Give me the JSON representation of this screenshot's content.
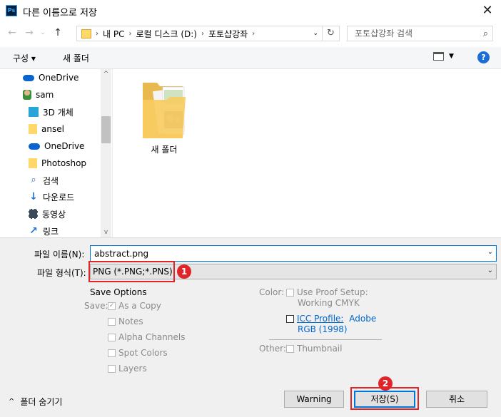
{
  "window": {
    "title": "다른 이름으로 저장",
    "app_icon": "Ps",
    "close": "✕"
  },
  "address": {
    "path": [
      "내 PC",
      "로컬 디스크 (D:)",
      "포토샵강좌"
    ]
  },
  "search": {
    "placeholder": "포토샵강좌 검색"
  },
  "toolbar": {
    "organize": "구성 ▾",
    "new_folder": "새 폴더",
    "help": "?"
  },
  "nav": {
    "items": [
      {
        "label": "OneDrive",
        "icon": "cloud-icon"
      },
      {
        "label": "sam",
        "icon": "user-icon"
      },
      {
        "label": "3D 개체",
        "icon": "3d-objects-icon"
      },
      {
        "label": "ansel",
        "icon": "folder-icon"
      },
      {
        "label": "OneDrive",
        "icon": "cloud-icon"
      },
      {
        "label": "Photoshop",
        "icon": "folder-icon"
      },
      {
        "label": "검색",
        "icon": "search-icon"
      },
      {
        "label": "다운로드",
        "icon": "download-icon"
      },
      {
        "label": "동영상",
        "icon": "video-icon"
      },
      {
        "label": "링크",
        "icon": "link-icon"
      }
    ]
  },
  "files": [
    {
      "label": "새 폴더",
      "icon": "folder-icon"
    }
  ],
  "form": {
    "filename_label": "파일 이름(N):",
    "filename_value": "abstract.png",
    "filetype_label": "파일 형식(T):",
    "filetype_value": "PNG (*.PNG;*.PNS)"
  },
  "save_options": {
    "title": "Save Options",
    "save_label": "Save:",
    "options": [
      "As a Copy",
      "Notes",
      "Alpha Channels",
      "Spot Colors",
      "Layers"
    ],
    "color_label": "Color:",
    "proof_setup": "Use Proof Setup:",
    "proof_value": "Working CMYK",
    "icc_link": "ICC Profile:",
    "icc_value": "Adobe",
    "icc_value2": "RGB (1998)",
    "other_label": "Other:",
    "thumbnail": "Thumbnail"
  },
  "footer": {
    "hide_folders": "폴더 숨기기",
    "warning": "Warning",
    "save": "저장(S)",
    "cancel": "취소"
  },
  "badges": {
    "one": "1",
    "two": "2"
  },
  "colors": {
    "accent": "#0078d7",
    "badge": "#e0242a",
    "link": "#0066cc"
  }
}
